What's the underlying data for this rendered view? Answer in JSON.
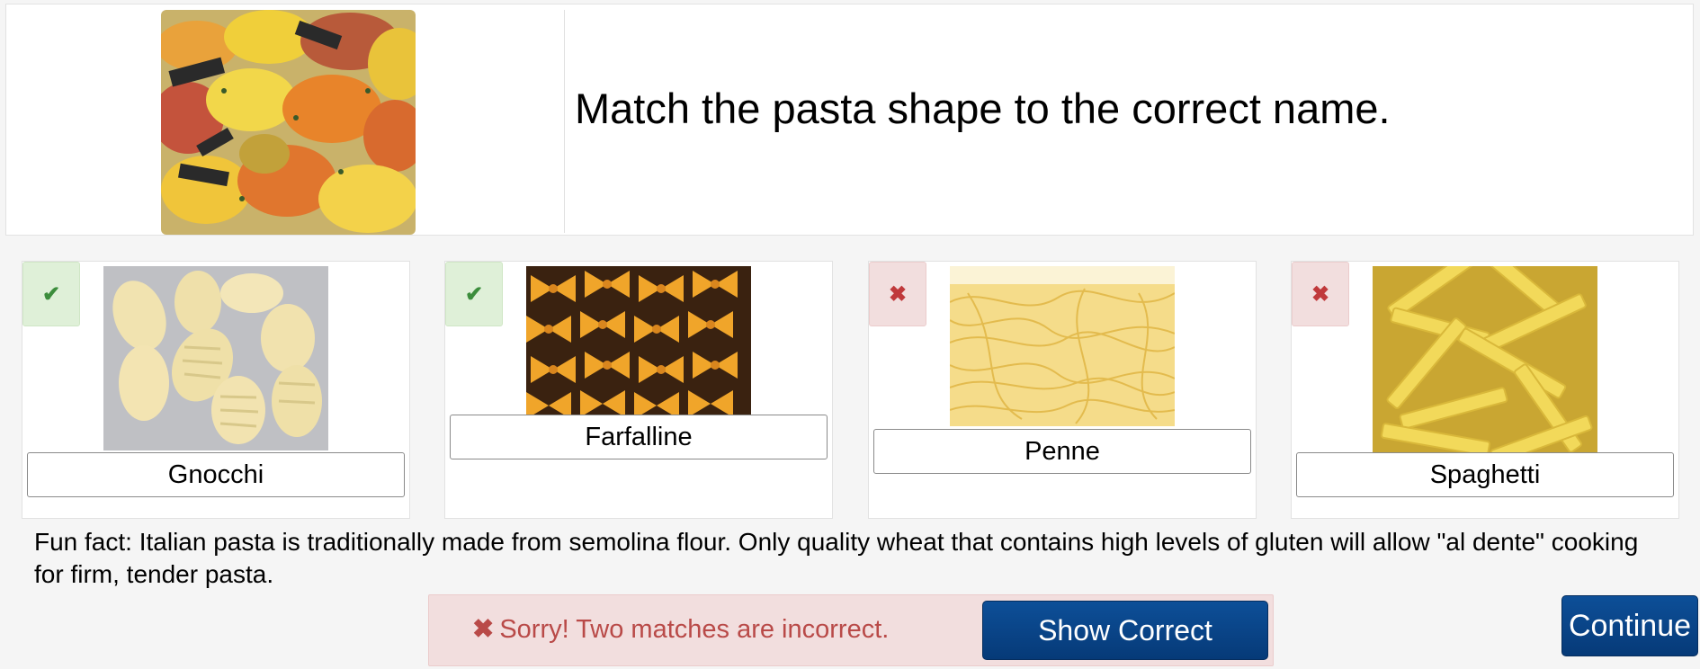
{
  "prompt": "Match the pasta shape to the correct name.",
  "header_image": "farfalle-tricolor-photo",
  "cards": [
    {
      "status": "correct",
      "badge_icon": "check-icon",
      "image": "gnocchi-photo",
      "label": "Gnocchi"
    },
    {
      "status": "correct",
      "badge_icon": "check-icon",
      "image": "farfalle-photo",
      "label": "Farfalline"
    },
    {
      "status": "incorrect",
      "badge_icon": "x-icon",
      "image": "spaghetti-photo",
      "label": "Penne"
    },
    {
      "status": "incorrect",
      "badge_icon": "x-icon",
      "image": "penne-photo",
      "label": "Spaghetti"
    }
  ],
  "fun_fact": "Fun fact: Italian pasta is traditionally made from semolina flour. Only quality wheat that contains high levels of gluten will allow \"al dente\" cooking for firm, tender pasta.",
  "feedback": {
    "icon": "✖",
    "message": "Sorry! Two matches are incorrect."
  },
  "buttons": {
    "show_correct": "Show Correct",
    "continue": "Continue"
  },
  "colors": {
    "button": "#063a78",
    "correct_bg": "#dff0d8",
    "incorrect_bg": "#f2dede",
    "error_text": "#b94a48"
  }
}
